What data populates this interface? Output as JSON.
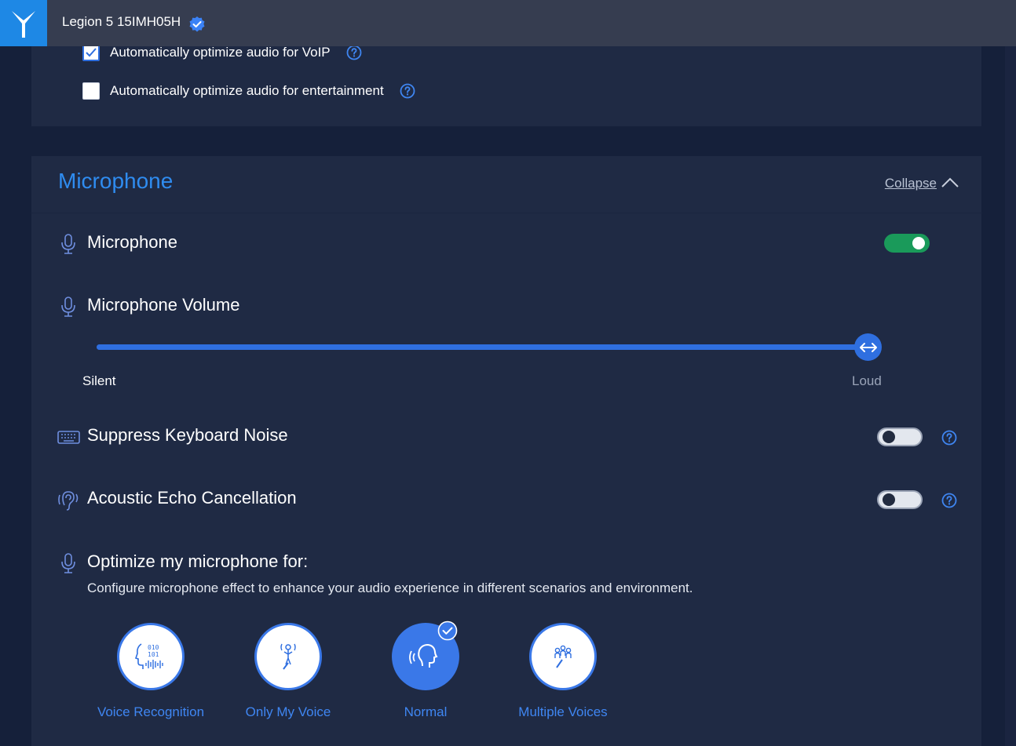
{
  "topbar": {
    "device_name": "Legion 5 15IMH05H",
    "logo_icon": "legion-y-logo",
    "verified_icon": "verified-check-icon"
  },
  "audio_options": {
    "voip_label": "Automatically optimize audio for VoIP",
    "voip_checked": true,
    "entertainment_label": "Automatically optimize audio for entertainment",
    "entertainment_checked": false
  },
  "microphone_section": {
    "title": "Microphone",
    "collapse_label": "Collapse",
    "microphone": {
      "label": "Microphone",
      "enabled": true
    },
    "volume": {
      "label": "Microphone Volume",
      "min_label": "Silent",
      "max_label": "Loud",
      "value_percent": 100
    },
    "suppress_keyboard": {
      "label": "Suppress Keyboard Noise",
      "enabled": false
    },
    "echo_cancellation": {
      "label": "Acoustic Echo Cancellation",
      "enabled": false
    },
    "optimize": {
      "title": "Optimize my microphone for:",
      "description": "Configure microphone effect to enhance your audio experience in different scenarios and environment.",
      "modes": [
        {
          "label": "Voice Recognition",
          "icon": "voice-recognition-icon",
          "selected": false
        },
        {
          "label": "Only My Voice",
          "icon": "only-my-voice-icon",
          "selected": false
        },
        {
          "label": "Normal",
          "icon": "normal-voice-icon",
          "selected": true
        },
        {
          "label": "Multiple Voices",
          "icon": "multiple-voices-icon",
          "selected": false
        }
      ]
    }
  },
  "colors": {
    "accent_blue": "#2f6fe0",
    "title_blue": "#2f8cf0",
    "toggle_on_green": "#1a9a5a",
    "panel_bg": "#1f2a44",
    "page_bg": "#15203a"
  }
}
